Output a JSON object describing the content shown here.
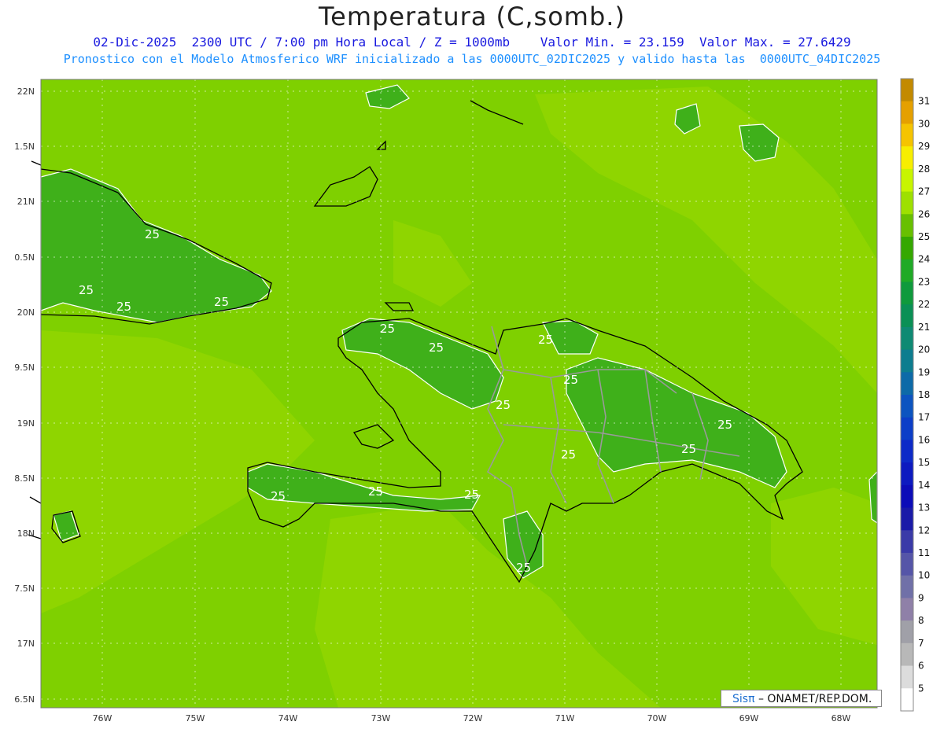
{
  "header": {
    "title": "Temperatura (C,somb.)",
    "subtitle_line1": "02-Dic-2025  2300 UTC / 7:00 pm Hora Local / Z = 1000mb    Valor Min. = 23.159  Valor Max. = 27.6429",
    "subtitle_line2": "Pronostico con el Modelo Atmosferico WRF inicializado a las 0000UTC_02DIC2025 y valido hasta las  0000UTC_04DIC2025"
  },
  "map": {
    "lat_labels": [
      "22N",
      "1.5N",
      "21N",
      "0.5N",
      "20N",
      "9.5N",
      "19N",
      "8.5N",
      "18N",
      "7.5N",
      "17N",
      "6.5N"
    ],
    "lon_labels": [
      "76W",
      "75W",
      "74W",
      "73W",
      "72W",
      "71W",
      "70W",
      "69W",
      "68W"
    ],
    "contour_labels": [
      "25",
      "25",
      "25",
      "25",
      "25",
      "25",
      "25",
      "25",
      "25",
      "25",
      "25",
      "25",
      "25",
      "25",
      "25",
      "25"
    ],
    "colors": {
      "bg": "#7fd000",
      "c24": "#3fb01a",
      "c25": "#63be00",
      "c26": "#8fd500",
      "c27": "#acea14"
    }
  },
  "colorbar": {
    "labels": [
      "31",
      "30",
      "29",
      "28",
      "27",
      "26",
      "25",
      "24",
      "23",
      "22",
      "21",
      "20",
      "19",
      "18",
      "17",
      "16",
      "15",
      "14",
      "13",
      "12",
      "11",
      "10",
      "9",
      "8",
      "7",
      "6",
      "5"
    ],
    "colors": [
      "#c38a00",
      "#e5a000",
      "#f5c400",
      "#f7ee00",
      "#c8f500",
      "#9ee000",
      "#68c000",
      "#35a800",
      "#1faa26",
      "#0f9a3c",
      "#0a9055",
      "#0e8a73",
      "#0d7d8f",
      "#0d6aa8",
      "#0c54c0",
      "#0c3ec8",
      "#0d2ac8",
      "#0d1ac0",
      "#0c0cb8",
      "#1a1aa8",
      "#3a3aa8",
      "#5555a8",
      "#7070a8",
      "#8f80a8",
      "#a0a0a8",
      "#b8b8b8",
      "#dcdcdc",
      "#ffffff"
    ]
  },
  "credit": {
    "logo": "Sisπ",
    "text": "– ONAMET/REP.DOM."
  }
}
